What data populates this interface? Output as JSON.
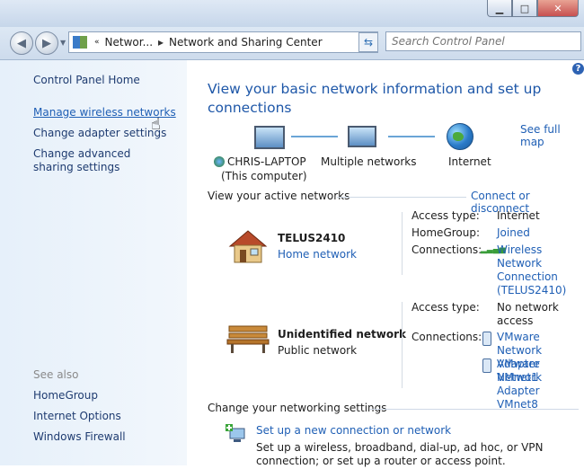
{
  "window": {
    "min_glyph": "▁",
    "max_glyph": "□",
    "close_glyph": "✕"
  },
  "nav": {
    "back_glyph": "◀",
    "forward_glyph": "▶",
    "recent_glyph": "▼",
    "address_sep": "«",
    "breadcrumb_1": "Networ...",
    "breadcrumb_sep": "▸",
    "breadcrumb_2": "Network and Sharing Center",
    "dropdown_glyph": "▼",
    "refresh_glyph": "⇆",
    "search_placeholder": "Search Control Panel"
  },
  "sidebar": {
    "home": "Control Panel Home",
    "manage_wireless": "Manage wireless networks",
    "adapter": "Change adapter settings",
    "advanced_sharing": "Change advanced sharing settings",
    "see_also": "See also",
    "homegroup": "HomeGroup",
    "internet_options": "Internet Options",
    "firewall": "Windows Firewall"
  },
  "main": {
    "title": "View your basic network information and set up connections",
    "see_full_map": "See full map",
    "help_glyph": "?",
    "map": {
      "computer": "CHRIS-LAPTOP",
      "computer_sub": "(This computer)",
      "multiple": "Multiple networks",
      "internet": "Internet"
    },
    "active_networks_title": "View your active networks",
    "connect_disconnect": "Connect or disconnect",
    "networks": [
      {
        "name": "TELUS2410",
        "type": "Home network",
        "access_label": "Access type:",
        "access_value": "Internet",
        "homegroup_label": "HomeGroup:",
        "homegroup_value": "Joined",
        "connections_label": "Connections:",
        "connection": "Wireless Network Connection (TELUS2410)"
      },
      {
        "name": "Unidentified network",
        "type": "Public network",
        "access_label": "Access type:",
        "access_value": "No network access",
        "connections_label": "Connections:",
        "connection_1": "VMware Network Adapter VMnet1",
        "connection_2": "VMware Network Adapter VMnet8"
      }
    ],
    "change_settings_title": "Change your networking settings",
    "setup_link": "Set up a new connection or network",
    "setup_desc": "Set up a wireless, broadband, dial-up, ad hoc, or VPN connection; or set up a router or access point."
  }
}
